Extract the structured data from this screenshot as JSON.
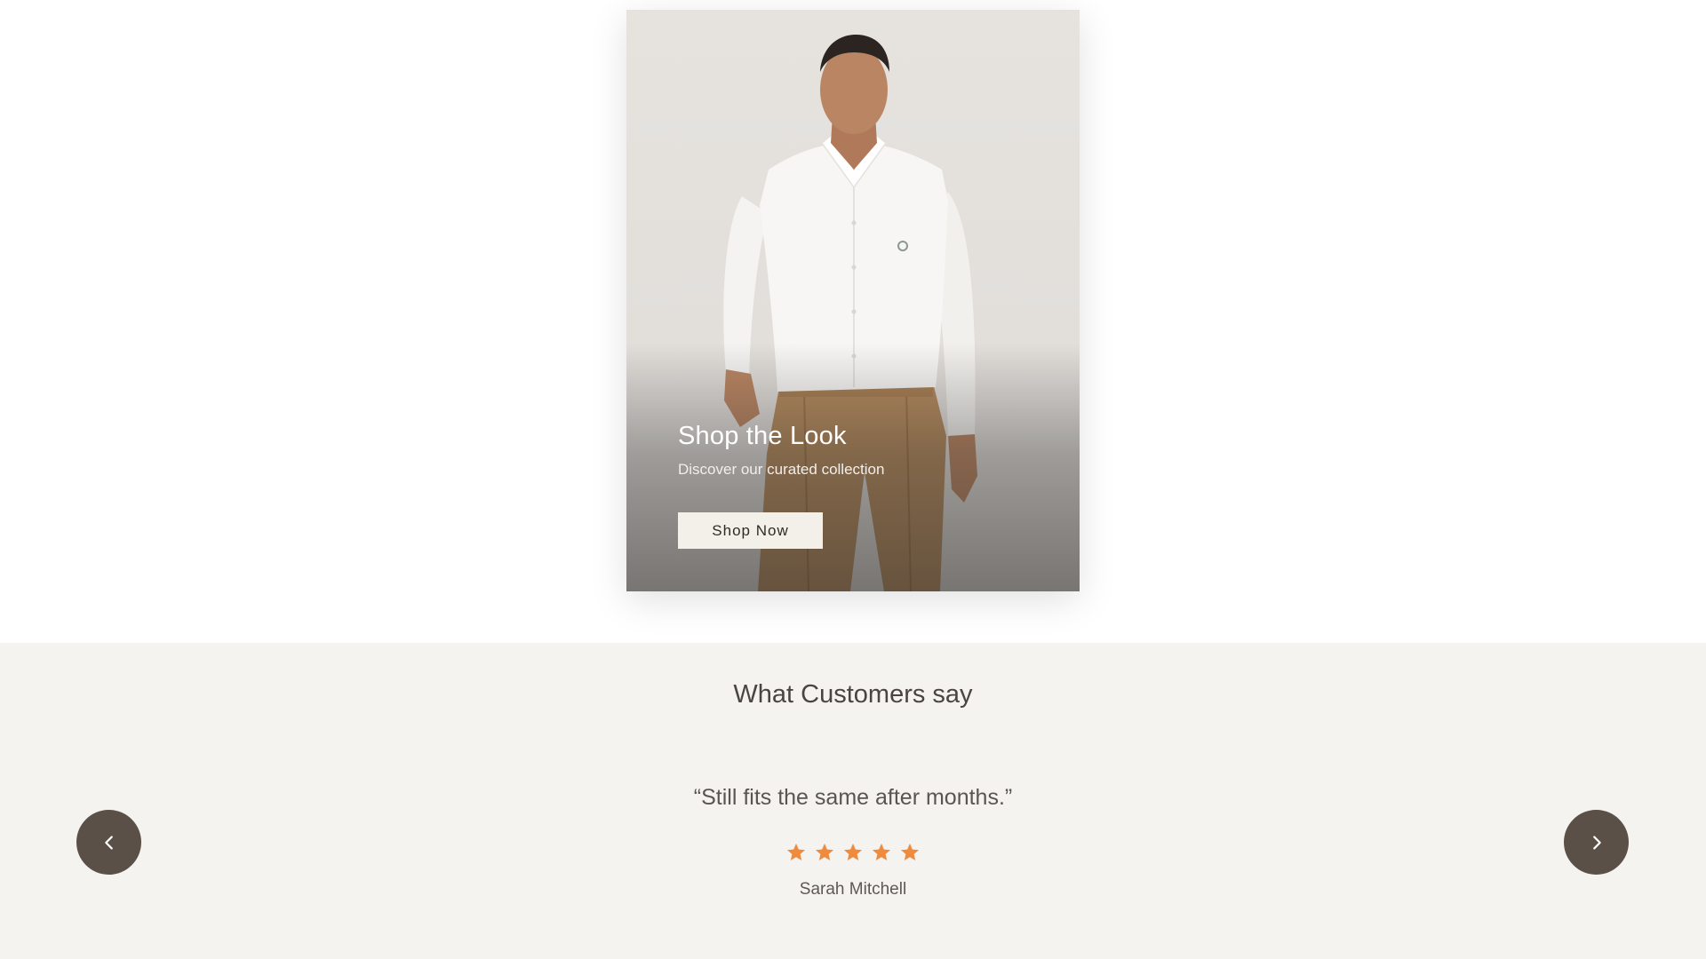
{
  "hero": {
    "title": "Shop the Look",
    "subtitle": "Discover our curated collection",
    "button_label": "Shop Now",
    "image_subject": "model in white shirt and tan trousers"
  },
  "testimonials": {
    "heading": "What Customers say",
    "quote": "“Still fits the same after months.”",
    "rating": 5,
    "rating_max": 5,
    "author": "Sarah Mitchell",
    "prev_icon": "chevron-left-icon",
    "next_icon": "chevron-right-icon"
  },
  "colors": {
    "page_background": "#ffffff",
    "section_background": "#f5f3f0",
    "star_color": "#f08a3c",
    "nav_button": "#5b5048",
    "button_background": "#f3efe9",
    "heading_text": "#4a4541"
  }
}
